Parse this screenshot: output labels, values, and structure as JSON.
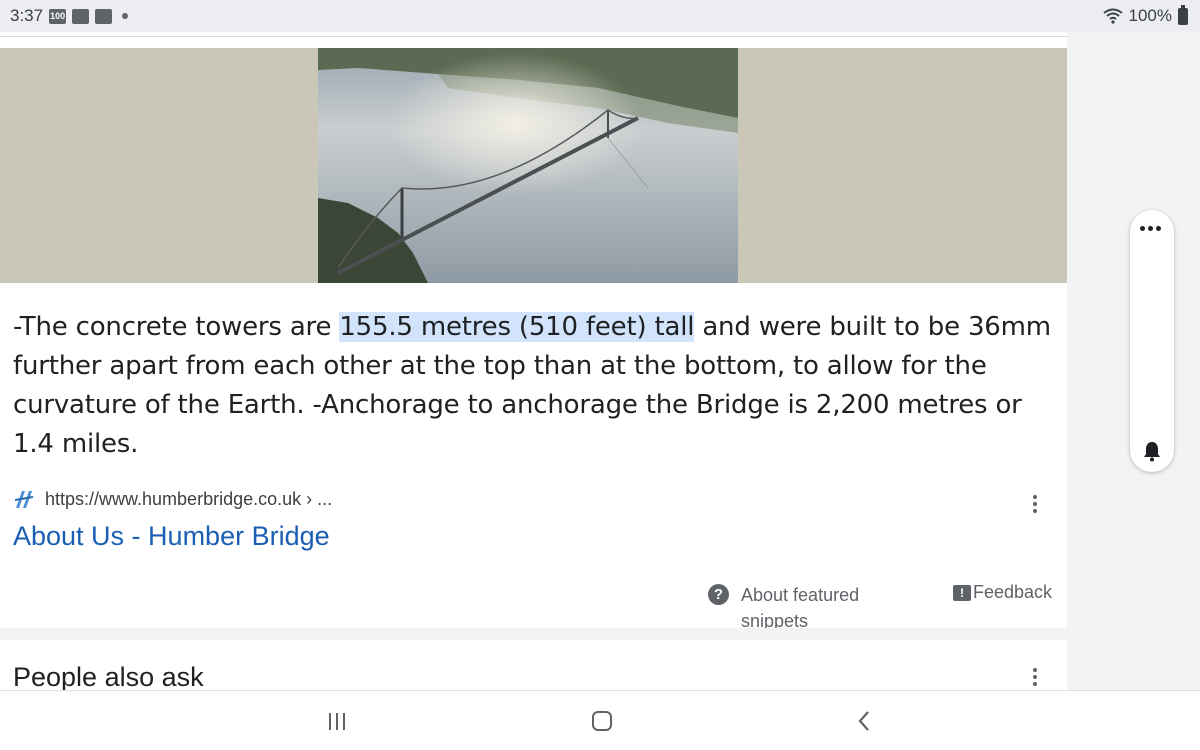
{
  "status_bar": {
    "time": "3:37",
    "notification_icons": [
      "100-icon",
      "image-icon",
      "image-icon"
    ],
    "battery": "100%"
  },
  "featured_snippet": {
    "image_alt": "Aerial view of the Humber Bridge over the estuary",
    "text_before": "-The concrete towers are ",
    "text_highlight": "155.5 metres (510 feet) tall",
    "text_after": " and were built to be 36mm further apart from each other at the top than at the bottom, to allow for the curvature of the Earth. -Anchorage to anchorage the Bridge is 2,200 metres or 1.4 miles.",
    "source_url": "https://www.humberbridge.co.uk › ...",
    "result_title": "About Us - Humber Bridge",
    "about_label": "About featured snippets",
    "feedback_label": "Feedback"
  },
  "people_also_ask": {
    "title": "People also ask"
  },
  "colors": {
    "link": "#1a5fb4",
    "highlight": "#d2e3fc",
    "image_band": "#cbc7b6"
  }
}
